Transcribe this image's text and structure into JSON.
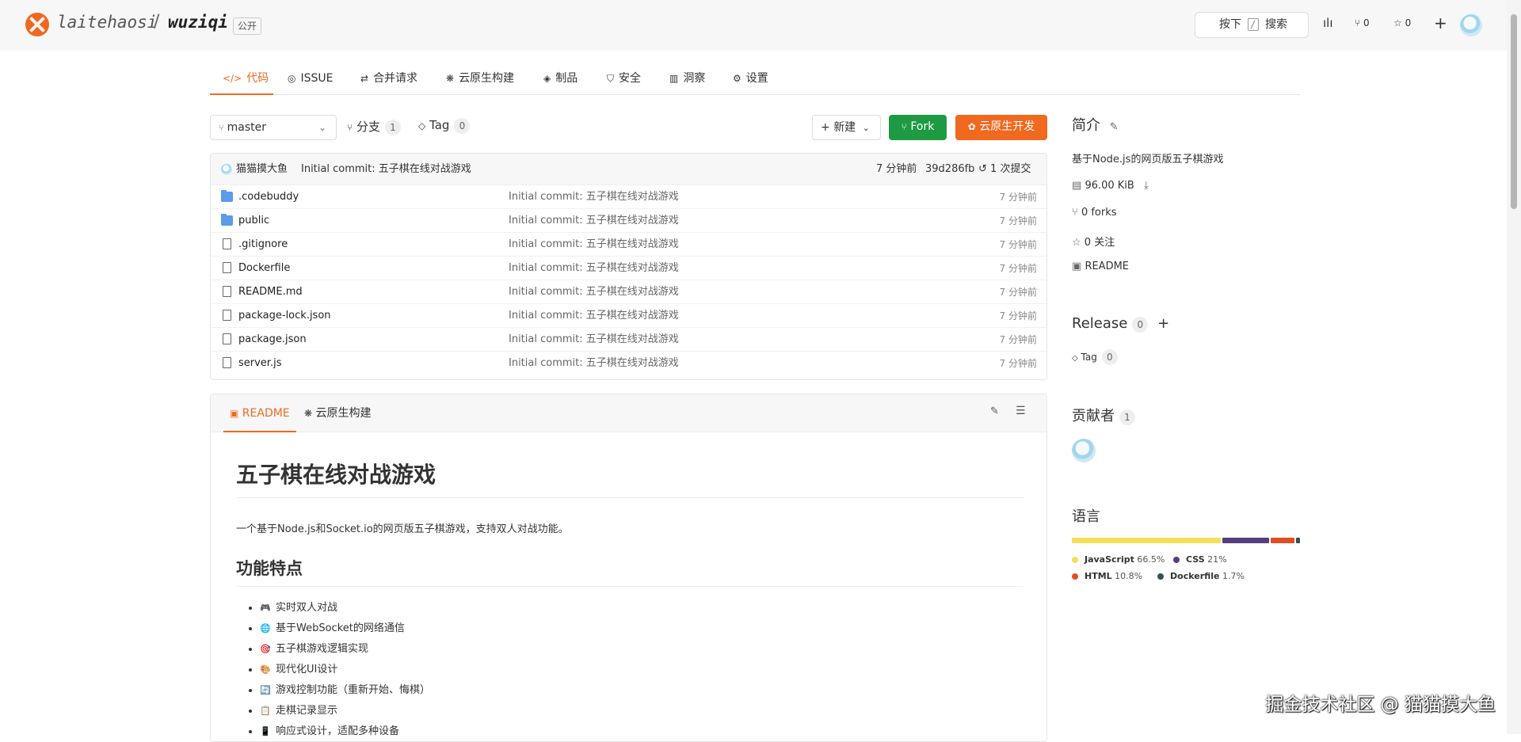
{
  "header": {
    "owner": "laitehaosi",
    "separator": "/",
    "repo": "wuziqi",
    "visibility": "公开",
    "search_shortcut_prefix": "按下",
    "search_label": "搜索",
    "fork_count": "0",
    "star_count": "0"
  },
  "tabs": [
    {
      "icon": "</>",
      "label": "代码"
    },
    {
      "icon": "◎",
      "label": "ISSUE"
    },
    {
      "icon": "⇄",
      "label": "合并请求"
    },
    {
      "icon": "❋",
      "label": "云原生构建"
    },
    {
      "icon": "◈",
      "label": "制品"
    },
    {
      "icon": "⛉",
      "label": "安全"
    },
    {
      "icon": "▥",
      "label": "洞察"
    },
    {
      "icon": "⚙",
      "label": "设置"
    }
  ],
  "toolbar": {
    "branch": "master",
    "branches_label": "分支",
    "branches_count": "1",
    "tags_label": "Tag",
    "tags_count": "0",
    "new_label": "新建",
    "fork_label": "Fork",
    "cloud_dev_label": "云原生开发"
  },
  "last_commit": {
    "author": "猫猫摸大鱼",
    "message": "Initial commit: 五子棋在线对战游戏",
    "time": "7 分钟前",
    "hash": "39d286fb",
    "commits": "1 次提交"
  },
  "files": [
    {
      "name": ".codebuddy",
      "type": "dir",
      "message": "Initial commit: 五子棋在线对战游戏",
      "time": "7 分钟前"
    },
    {
      "name": "public",
      "type": "dir",
      "message": "Initial commit: 五子棋在线对战游戏",
      "time": "7 分钟前"
    },
    {
      "name": ".gitignore",
      "type": "file",
      "message": "Initial commit: 五子棋在线对战游戏",
      "time": "7 分钟前"
    },
    {
      "name": "Dockerfile",
      "type": "file",
      "message": "Initial commit: 五子棋在线对战游戏",
      "time": "7 分钟前"
    },
    {
      "name": "README.md",
      "type": "file",
      "message": "Initial commit: 五子棋在线对战游戏",
      "time": "7 分钟前"
    },
    {
      "name": "package-lock.json",
      "type": "file",
      "message": "Initial commit: 五子棋在线对战游戏",
      "time": "7 分钟前"
    },
    {
      "name": "package.json",
      "type": "file",
      "message": "Initial commit: 五子棋在线对战游戏",
      "time": "7 分钟前"
    },
    {
      "name": "server.js",
      "type": "file",
      "message": "Initial commit: 五子棋在线对战游戏",
      "time": "7 分钟前"
    }
  ],
  "readme": {
    "tab_readme": "README",
    "tab_build": "云原生构建",
    "title": "五子棋在线对战游戏",
    "intro": "一个基于Node.js和Socket.io的网页版五子棋游戏，支持双人对战功能。",
    "features_heading": "功能特点",
    "features": [
      {
        "emoji": "🎮",
        "text": "实时双人对战"
      },
      {
        "emoji": "🌐",
        "text": "基于WebSocket的网络通信"
      },
      {
        "emoji": "🎯",
        "text": "五子棋游戏逻辑实现"
      },
      {
        "emoji": "🎨",
        "text": "现代化UI设计"
      },
      {
        "emoji": "🔄",
        "text": "游戏控制功能（重新开始、悔棋）"
      },
      {
        "emoji": "📋",
        "text": "走棋记录显示"
      },
      {
        "emoji": "📱",
        "text": "响应式设计，适配多种设备"
      }
    ]
  },
  "sidebar": {
    "about_title": "简介",
    "description": "基于Node.js的网页版五子棋游戏",
    "size": "96.00 KiB",
    "forks": "0 forks",
    "watchers": "0 关注",
    "readme": "README",
    "release_title": "Release",
    "release_count": "0",
    "tag_label": "Tag",
    "tag_count": "0",
    "contributors_title": "贡献者",
    "contributors_count": "1",
    "languages_title": "语言",
    "languages": [
      {
        "name": "JavaScript",
        "percent": "66.5%",
        "value": 66.5,
        "color": "#f1e05a"
      },
      {
        "name": "CSS",
        "percent": "21%",
        "value": 21,
        "color": "#563d7c"
      },
      {
        "name": "HTML",
        "percent": "10.8%",
        "value": 10.8,
        "color": "#e34c26"
      },
      {
        "name": "Dockerfile",
        "percent": "1.7%",
        "value": 1.7,
        "color": "#384d54"
      }
    ]
  },
  "watermark": "掘金技术社区 @ 猫猫摸大鱼"
}
